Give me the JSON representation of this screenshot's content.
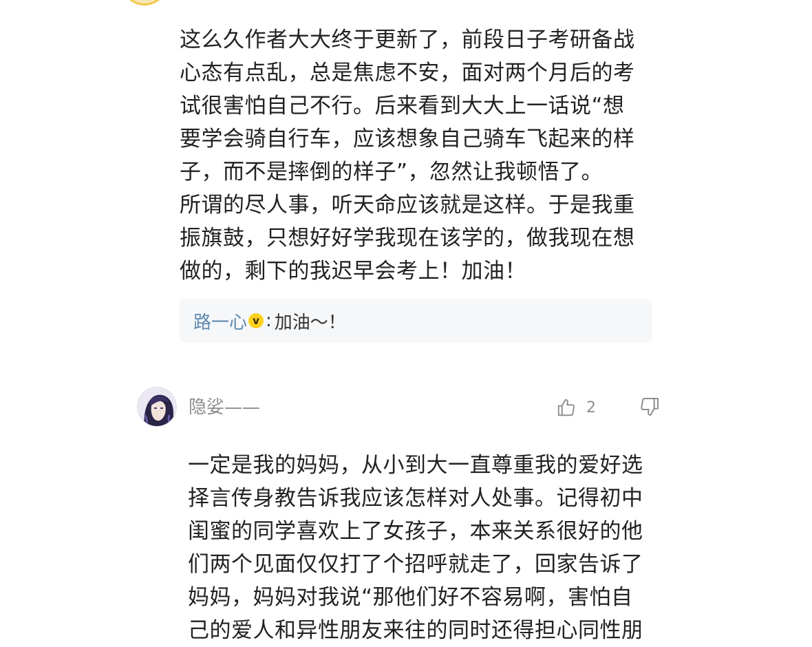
{
  "comment1": {
    "text": "这么久作者大大终于更新了，前段日子考研备战\n心态有点乱，总是焦虑不安，面对两个月后的考\n试很害怕自己不行。后来看到大大上一话说“想\n要学会骑自行车，应该想象自己骑车飞起来的样\n子，而不是摔倒的样子”，忽然让我顿悟了。\n所谓的尽人事，听天命应该就是这样。于是我重\n振旗鼓，只想好好学我现在该学的，做我现在想\n做的，剩下的我迟早会考上！加油！",
    "reply": {
      "author": "路一心",
      "badge": "v",
      "separator": ":",
      "text": "加油～！"
    }
  },
  "comment2": {
    "username": "隐娑——",
    "likes": "2",
    "text": "一定是我的妈妈，从小到大一直尊重我的爱好选\n择言传身教告诉我应该怎样对人处事。记得初中\n闺蜜的同学喜欢上了女孩子，本来关系很好的他\n们两个见面仅仅打了个招呼就走了，回家告诉了\n妈妈，妈妈对我说“那他们好不容易啊，害怕自\n己的爱人和异性朋友来往的同时还得担心同性朋"
  },
  "icons": {
    "like": "thumbs-up-icon",
    "dislike": "thumbs-down-icon",
    "vip": "vip-badge-icon"
  },
  "colors": {
    "reply_author": "#5e89b0",
    "vip_badge": "#ffd21e",
    "reply_background": "#f6f7f9",
    "meta_gray": "#8c8c8c"
  }
}
